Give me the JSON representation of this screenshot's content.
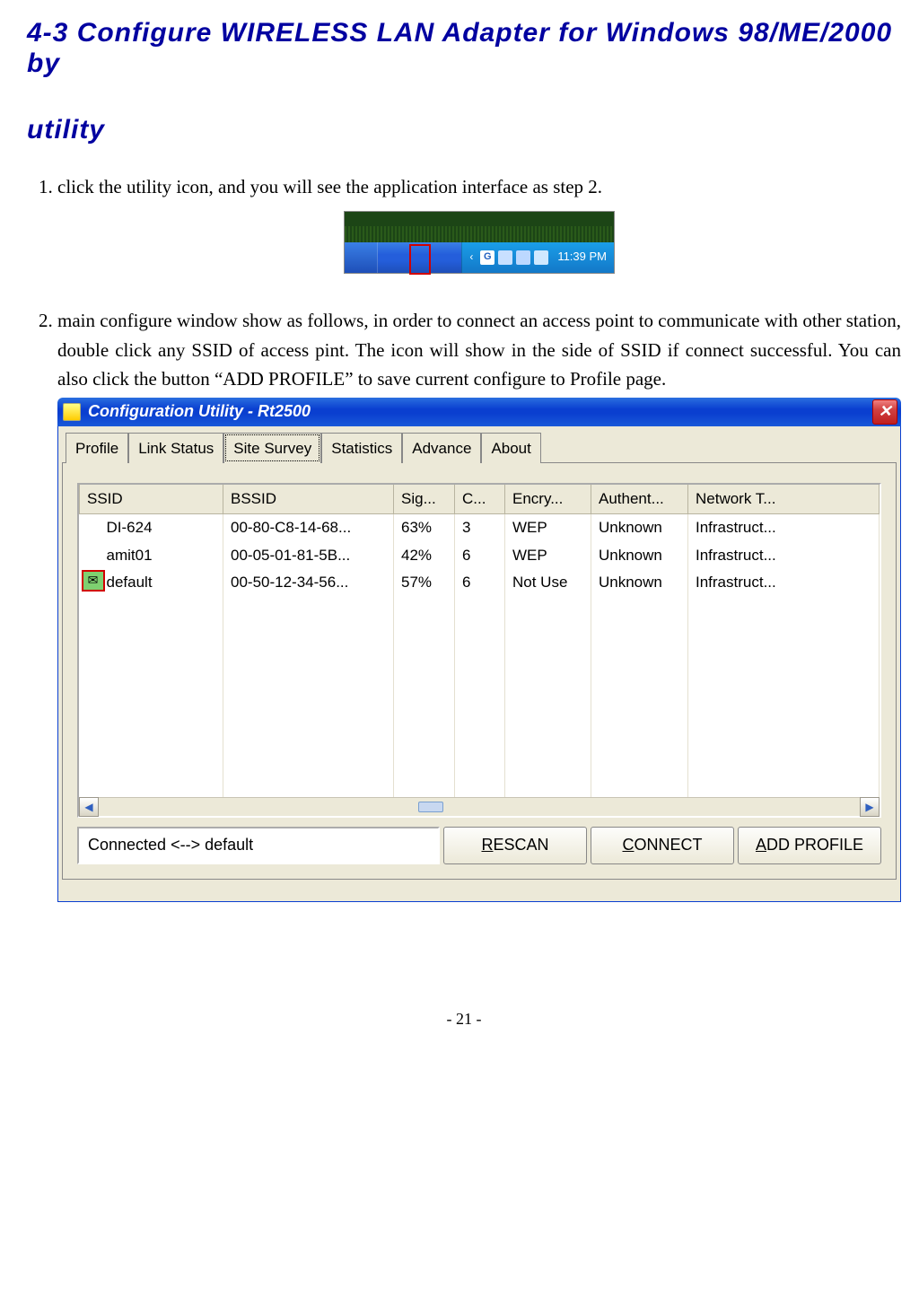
{
  "heading_part1": "4-3 Configure WIRELESS LAN Adapter for Windows 98/ME/2000 by",
  "heading_part2": "utility",
  "steps": {
    "s1": "click the utility icon, and you will see the application interface as step 2.",
    "s2": "main configure window show as follows, in order to connect an access point to communicate with other station, double click any SSID of access pint. The icon will show in the side of SSID if connect successful. You can also click the button “ADD PROFILE” to save current configure to Profile page."
  },
  "systray": {
    "clock": "11:39 PM"
  },
  "cfg": {
    "title": "Configuration Utility - Rt2500",
    "tabs": [
      "Profile",
      "Link Status",
      "Site Survey",
      "Statistics",
      "Advance",
      "About"
    ],
    "columns": [
      "SSID",
      "BSSID",
      "Sig...",
      "C...",
      "Encry...",
      "Authent...",
      "Network T..."
    ],
    "rows": [
      {
        "ssid": "DI-624",
        "bssid": "00-80-C8-14-68...",
        "sig": "63%",
        "ch": "3",
        "enc": "WEP",
        "auth": "Unknown",
        "net": "Infrastruct...",
        "connected": false
      },
      {
        "ssid": "amit01",
        "bssid": "00-05-01-81-5B...",
        "sig": "42%",
        "ch": "6",
        "enc": "WEP",
        "auth": "Unknown",
        "net": "Infrastruct...",
        "connected": false
      },
      {
        "ssid": "default",
        "bssid": "00-50-12-34-56...",
        "sig": "57%",
        "ch": "6",
        "enc": "Not Use",
        "auth": "Unknown",
        "net": "Infrastruct...",
        "connected": true
      }
    ],
    "status": "Connected <--> default",
    "buttons": {
      "rescan_pre": "R",
      "rescan_rest": "ESCAN",
      "connect_pre": "C",
      "connect_rest": "ONNECT",
      "addprofile_pre": "A",
      "addprofile_rest": "DD PROFILE"
    }
  },
  "page_number": "- 21 -"
}
